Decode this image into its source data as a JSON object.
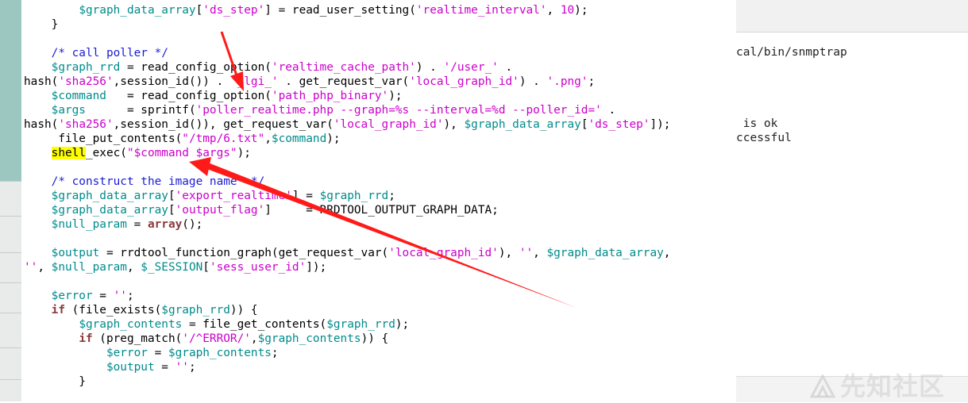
{
  "background_window": {
    "lines": [
      "cal/bin/snmptrap",
      " is ok",
      "ccessful"
    ]
  },
  "watermark": {
    "text": "先知社区"
  },
  "code": {
    "lines": [
      [
        {
          "t": "        "
        },
        {
          "t": "$graph_data_array",
          "c": "var"
        },
        {
          "t": "["
        },
        {
          "t": "'ds_step'",
          "c": "str"
        },
        {
          "t": "] = read_user_setting("
        },
        {
          "t": "'realtime_interval'",
          "c": "str"
        },
        {
          "t": ", "
        },
        {
          "t": "10",
          "c": "num"
        },
        {
          "t": ");"
        }
      ],
      [
        {
          "t": "    }"
        }
      ],
      [
        {
          "t": ""
        }
      ],
      [
        {
          "t": "    "
        },
        {
          "t": "/* call poller */",
          "c": "cmt"
        }
      ],
      [
        {
          "t": "    "
        },
        {
          "t": "$graph_rrd",
          "c": "var"
        },
        {
          "t": " = read_config_option("
        },
        {
          "t": "'realtime_cache_path'",
          "c": "str"
        },
        {
          "t": ") . "
        },
        {
          "t": "'/user_'",
          "c": "str"
        },
        {
          "t": " ."
        }
      ],
      [
        {
          "t": "hash("
        },
        {
          "t": "'sha256'",
          "c": "str"
        },
        {
          "t": ",session_id()) . "
        },
        {
          "t": "'_lgi_'",
          "c": "str"
        },
        {
          "t": " . get_request_var("
        },
        {
          "t": "'local_graph_id'",
          "c": "str"
        },
        {
          "t": ") . "
        },
        {
          "t": "'.png'",
          "c": "str"
        },
        {
          "t": ";"
        }
      ],
      [
        {
          "t": "    "
        },
        {
          "t": "$command",
          "c": "var"
        },
        {
          "t": "   = read_config_option("
        },
        {
          "t": "'path_php_binary'",
          "c": "str"
        },
        {
          "t": ");"
        }
      ],
      [
        {
          "t": "    "
        },
        {
          "t": "$args",
          "c": "var"
        },
        {
          "t": "      = sprintf("
        },
        {
          "t": "'poller_realtime.php --graph=%s --interval=%d --poller_id='",
          "c": "str"
        },
        {
          "t": " ."
        }
      ],
      [
        {
          "t": "hash("
        },
        {
          "t": "'sha256'",
          "c": "str"
        },
        {
          "t": ",session_id()), get_request_var("
        },
        {
          "t": "'local_graph_id'",
          "c": "str"
        },
        {
          "t": "), "
        },
        {
          "t": "$graph_data_array",
          "c": "var"
        },
        {
          "t": "["
        },
        {
          "t": "'ds_step'",
          "c": "str"
        },
        {
          "t": "]);"
        }
      ],
      [
        {
          "t": "     file_put_contents("
        },
        {
          "t": "\"/tmp/6.txt\"",
          "c": "str"
        },
        {
          "t": ","
        },
        {
          "t": "$command",
          "c": "var"
        },
        {
          "t": ");"
        }
      ],
      [
        {
          "t": "    "
        },
        {
          "t": "shell",
          "c": "hl"
        },
        {
          "t": "_exec("
        },
        {
          "t": "\"$command $args\"",
          "c": "str"
        },
        {
          "t": ");"
        }
      ],
      [
        {
          "t": ""
        }
      ],
      [
        {
          "t": "    "
        },
        {
          "t": "/* construct the image name  */",
          "c": "cmt"
        }
      ],
      [
        {
          "t": "    "
        },
        {
          "t": "$graph_data_array",
          "c": "var"
        },
        {
          "t": "["
        },
        {
          "t": "'export_realtime'",
          "c": "str"
        },
        {
          "t": "] = "
        },
        {
          "t": "$graph_rrd",
          "c": "var"
        },
        {
          "t": ";"
        }
      ],
      [
        {
          "t": "    "
        },
        {
          "t": "$graph_data_array",
          "c": "var"
        },
        {
          "t": "["
        },
        {
          "t": "'output_flag'",
          "c": "str"
        },
        {
          "t": "]     = RRDTOOL_OUTPUT_GRAPH_DATA;"
        }
      ],
      [
        {
          "t": "    "
        },
        {
          "t": "$null_param",
          "c": "var"
        },
        {
          "t": " = "
        },
        {
          "t": "array",
          "c": "kw"
        },
        {
          "t": "();"
        }
      ],
      [
        {
          "t": ""
        }
      ],
      [
        {
          "t": "    "
        },
        {
          "t": "$output",
          "c": "var"
        },
        {
          "t": " = rrdtool_function_graph(get_request_var("
        },
        {
          "t": "'local_graph_id'",
          "c": "str"
        },
        {
          "t": "), "
        },
        {
          "t": "''",
          "c": "str"
        },
        {
          "t": ", "
        },
        {
          "t": "$graph_data_array",
          "c": "var"
        },
        {
          "t": ","
        }
      ],
      [
        {
          "t": "''",
          "c": "str"
        },
        {
          "t": ", "
        },
        {
          "t": "$null_param",
          "c": "var"
        },
        {
          "t": ", "
        },
        {
          "t": "$_SESSION",
          "c": "var"
        },
        {
          "t": "["
        },
        {
          "t": "'sess_user_id'",
          "c": "str"
        },
        {
          "t": "]);"
        }
      ],
      [
        {
          "t": ""
        }
      ],
      [
        {
          "t": "    "
        },
        {
          "t": "$error",
          "c": "var"
        },
        {
          "t": " = "
        },
        {
          "t": "''",
          "c": "str"
        },
        {
          "t": ";"
        }
      ],
      [
        {
          "t": "    "
        },
        {
          "t": "if",
          "c": "kw"
        },
        {
          "t": " (file_exists("
        },
        {
          "t": "$graph_rrd",
          "c": "var"
        },
        {
          "t": ")) {"
        }
      ],
      [
        {
          "t": "        "
        },
        {
          "t": "$graph_contents",
          "c": "var"
        },
        {
          "t": " = file_get_contents("
        },
        {
          "t": "$graph_rrd",
          "c": "var"
        },
        {
          "t": ");"
        }
      ],
      [
        {
          "t": "        "
        },
        {
          "t": "if",
          "c": "kw"
        },
        {
          "t": " (preg_match("
        },
        {
          "t": "'/^ERROR/'",
          "c": "str"
        },
        {
          "t": ","
        },
        {
          "t": "$graph_contents",
          "c": "var"
        },
        {
          "t": ")) {"
        }
      ],
      [
        {
          "t": "            "
        },
        {
          "t": "$error",
          "c": "var"
        },
        {
          "t": " = "
        },
        {
          "t": "$graph_contents",
          "c": "var"
        },
        {
          "t": ";"
        }
      ],
      [
        {
          "t": "            "
        },
        {
          "t": "$output",
          "c": "var"
        },
        {
          "t": " = "
        },
        {
          "t": "''",
          "c": "str"
        },
        {
          "t": ";"
        }
      ],
      [
        {
          "t": "        }"
        }
      ]
    ]
  },
  "colors": {
    "variable": "#008b8b",
    "string": "#cc00cc",
    "keyword": "#8b3a3a",
    "comment": "#1c1cd6",
    "highlight": "#ffff00",
    "arrow": "#ff1a1a"
  },
  "icons": [
    "watermark-logo-icon",
    "annotation-arrow-icon"
  ]
}
